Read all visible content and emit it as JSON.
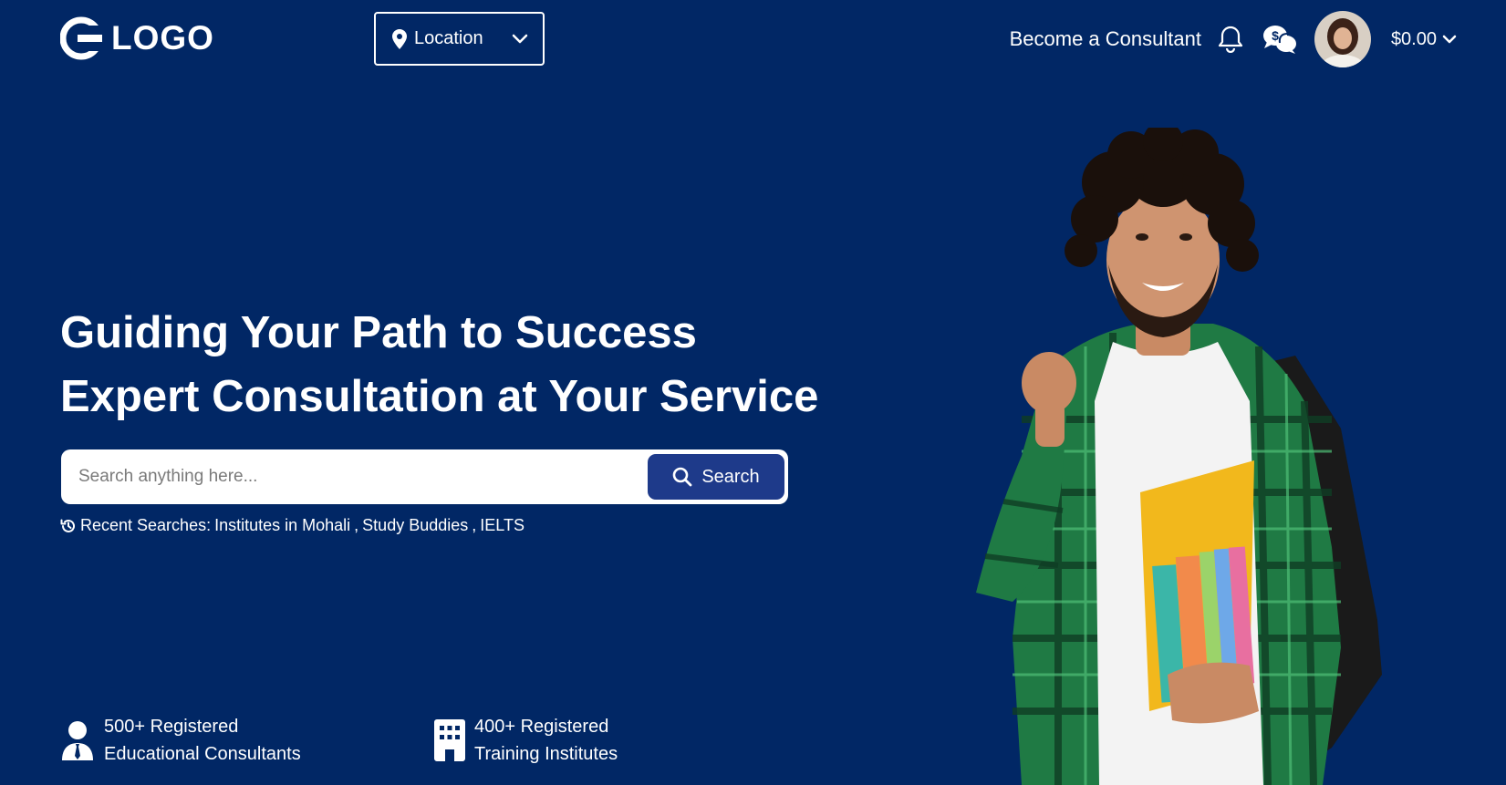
{
  "header": {
    "logo_text": "LOGO",
    "location_label": "Location",
    "become_consultant": "Become a Consultant",
    "wallet_amount": "$0.00",
    "icons": [
      "location-pin-icon",
      "chevron-down-icon",
      "bell-icon",
      "chat-dollar-icon",
      "avatar"
    ]
  },
  "hero": {
    "title_line1": "Guiding Your Path to Success",
    "title_line2": "Expert Consultation at Your Service",
    "search_placeholder": "Search anything here...",
    "search_button": "Search",
    "recent_prefix": "Recent Searches:",
    "recent_searches": [
      "Institutes in Mohali",
      "Study Buddies",
      "IELTS"
    ]
  },
  "stats": [
    {
      "line1": "500+ Registered",
      "line2": "Educational Consultants",
      "icon": "consultant-icon"
    },
    {
      "line1": "400+ Registered",
      "line2": "Training Institutes",
      "icon": "building-icon"
    }
  ],
  "colors": {
    "background": "#012765",
    "button": "#1e3a8a",
    "text": "#ffffff"
  }
}
